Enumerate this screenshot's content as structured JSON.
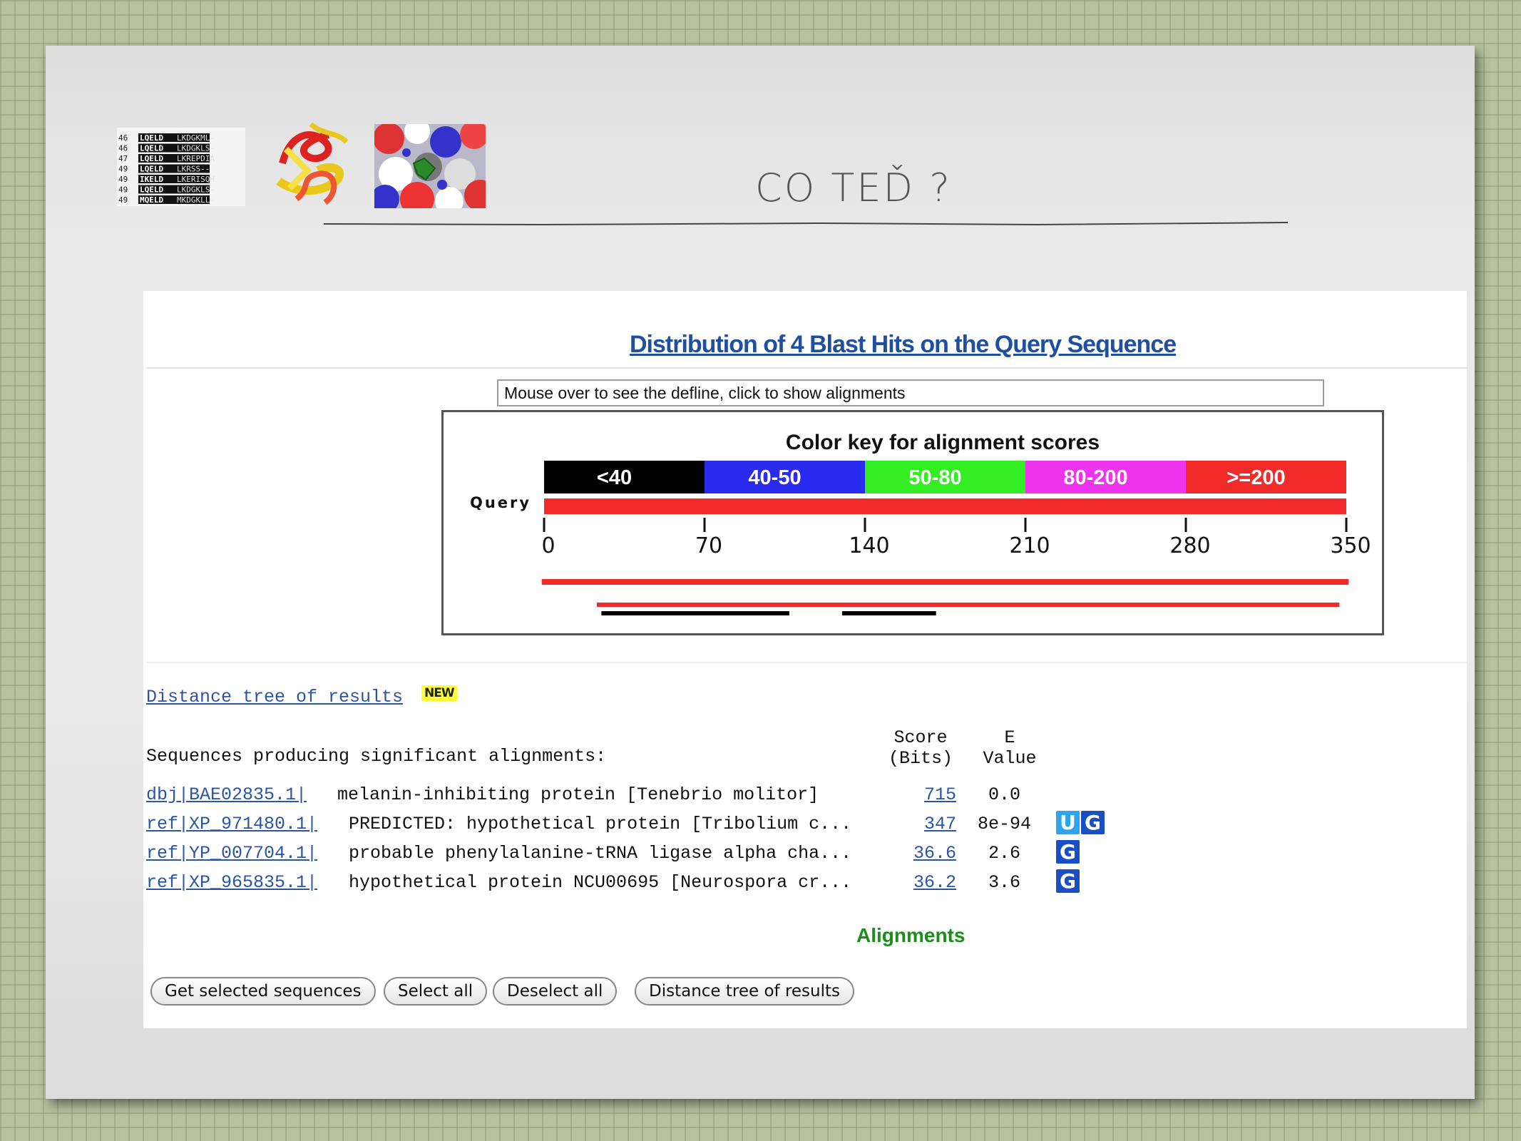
{
  "slide": {
    "title": "CO TEĎ ?",
    "thumbnails": {
      "alignment_rows": [
        {
          "num": "46",
          "seq": "LQELD",
          "tail": "LKDGKML-"
        },
        {
          "num": "46",
          "seq": "LQELD",
          "tail": "LKDGKLS-"
        },
        {
          "num": "47",
          "seq": "LQELD",
          "tail": "LKREPDIA"
        },
        {
          "num": "49",
          "seq": "LQELD",
          "tail": "LKRSS--"
        },
        {
          "num": "49",
          "seq": "IKELD",
          "tail": "LKERISQH"
        },
        {
          "num": "49",
          "seq": "LQELD",
          "tail": "LKDGKLS-"
        },
        {
          "num": "49",
          "seq": "MQELD",
          "tail": "MKDGKLL-"
        }
      ]
    }
  },
  "blast": {
    "heading": "Distribution of 4 Blast Hits on the Query Sequence",
    "defline_hint": "Mouse over to see the defline, click to show alignments",
    "color_key": {
      "title": "Color key for alignment scores",
      "bins": [
        {
          "label": "<40",
          "color": "#000000"
        },
        {
          "label": "40-50",
          "color": "#2b2bf0"
        },
        {
          "label": "50-80",
          "color": "#33ee22"
        },
        {
          "label": "80-200",
          "color": "#ee33ee"
        },
        {
          "label": ">=200",
          "color": "#f22a2a"
        }
      ],
      "query_label": "Query",
      "query_color": "#f22a2a",
      "axis_min": 0,
      "axis_max": 350,
      "ticks": [
        "0",
        "70",
        "140",
        "210",
        "280",
        "350"
      ]
    },
    "hit_bars": [
      {
        "color": "#f22a2a",
        "segments": [
          [
            -1,
            351
          ]
        ]
      },
      {
        "color": "#f22a2a",
        "segments": [
          [
            23,
            347
          ]
        ]
      },
      {
        "color": "#000000",
        "segments": [
          [
            25,
            107
          ],
          [
            130,
            171
          ]
        ]
      }
    ],
    "tree_link": "Distance tree of results",
    "new_badge": "NEW",
    "seq_header": "Sequences producing significant alignments:",
    "col_score": "Score\n(Bits)",
    "col_evalue": "E\nValue",
    "rows": [
      {
        "acc": "dbj|BAE02835.1|",
        "desc": "melanin-inhibiting protein [Tenebrio molitor]",
        "score": "715",
        "evalue": "0.0",
        "badges": []
      },
      {
        "acc": "ref|XP_971480.1|",
        "desc": "PREDICTED: hypothetical protein [Tribolium c...",
        "score": "347",
        "evalue": "8e-94",
        "badges": [
          "U",
          "G"
        ]
      },
      {
        "acc": "ref|YP_007704.1|",
        "desc": "probable phenylalanine-tRNA ligase alpha cha...",
        "score": "36.6",
        "evalue": "2.6",
        "badges": [
          "G"
        ]
      },
      {
        "acc": "ref|XP_965835.1|",
        "desc": "hypothetical protein NCU00695 [Neurospora cr...",
        "score": "36.2",
        "evalue": "3.6",
        "badges": [
          "G"
        ]
      }
    ],
    "alignments_label": "Alignments",
    "buttons": {
      "get_selected": "Get selected sequences",
      "select_all": "Select all",
      "deselect_all": "Deselect all",
      "distance_tree": "Distance tree of results"
    }
  }
}
